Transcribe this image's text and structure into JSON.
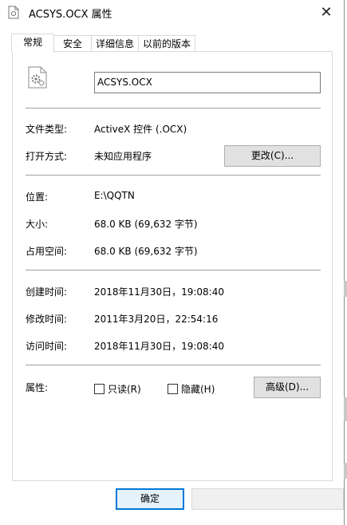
{
  "window": {
    "title": "ACSYS.OCX 属性"
  },
  "tabs": [
    {
      "label": "常规"
    },
    {
      "label": "安全"
    },
    {
      "label": "详细信息"
    },
    {
      "label": "以前的版本"
    }
  ],
  "general": {
    "file_name": "ACSYS.OCX",
    "file_type_label": "文件类型:",
    "file_type_value": "ActiveX 控件 (.OCX)",
    "opens_with_label": "打开方式:",
    "opens_with_value": "未知应用程序",
    "change_button": "更改(C)...",
    "location_label": "位置:",
    "location_value": "E:\\QQTN",
    "size_label": "大小:",
    "size_value": "68.0 KB (69,632 字节)",
    "size_on_disk_label": "占用空间:",
    "size_on_disk_value": "68.0 KB (69,632 字节)",
    "created_label": "创建时间:",
    "created_value": "2018年11月30日，19:08:40",
    "modified_label": "修改时间:",
    "modified_value": "2011年3月20日，22:54:16",
    "accessed_label": "访问时间:",
    "accessed_value": "2018年11月30日，19:08:40",
    "attributes_label": "属性:",
    "readonly_label": "只读(R)",
    "readonly_checked": false,
    "hidden_label": "隐藏(H)",
    "hidden_checked": false,
    "advanced_button": "高级(D)..."
  },
  "footer": {
    "ok_button": "确定"
  }
}
